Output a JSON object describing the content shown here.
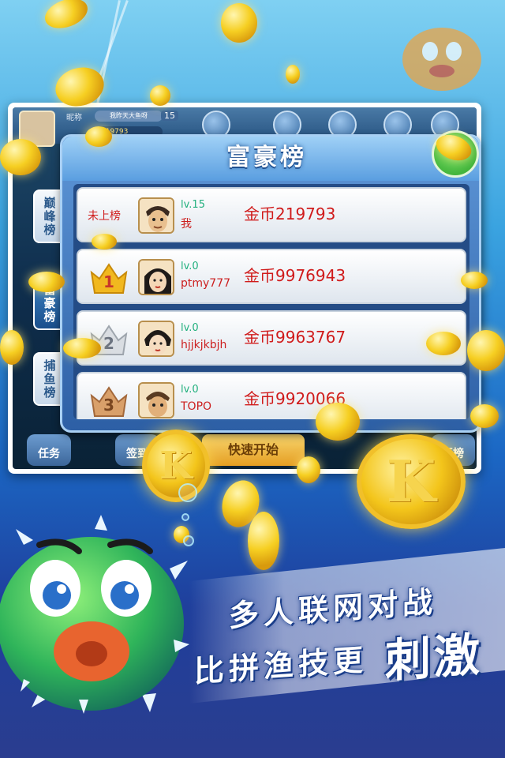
{
  "game_topbar": {
    "nick_label": "昵称",
    "nick_value": "我昨天大鱼呀",
    "level": "15",
    "coin_value": "219793"
  },
  "side_tabs": [
    "巅峰榜",
    "富豪榜",
    "捕鱼榜"
  ],
  "bottom_bar": {
    "task": "任务",
    "checkin": "签到",
    "quick_start": "快速开始",
    "rank": "行榜"
  },
  "leaderboard": {
    "title": "富豪榜",
    "close_symbol": "✕",
    "rows": [
      {
        "rank": "未上榜",
        "level": "lv.15",
        "name": "我",
        "coins": "金币219793"
      },
      {
        "rank": "1",
        "level": "lv.0",
        "name": "ptmy777",
        "coins": "金币9976943"
      },
      {
        "rank": "2",
        "level": "lv.0",
        "name": "hjjkjkbjh",
        "coins": "金币9963767"
      },
      {
        "rank": "3",
        "level": "lv.0",
        "name": "TOPO",
        "coins": "金币9920066"
      }
    ]
  },
  "banner": {
    "line1": "多人联网对战",
    "line2": "比拼渔技更",
    "line3": "刺激"
  },
  "colors": {
    "gold_crown": "#f1b81f",
    "silver_crown": "#c9cdd3",
    "bronze_crown": "#c98a52",
    "coin_text": "#d01b1b",
    "level_text": "#22b07e"
  }
}
